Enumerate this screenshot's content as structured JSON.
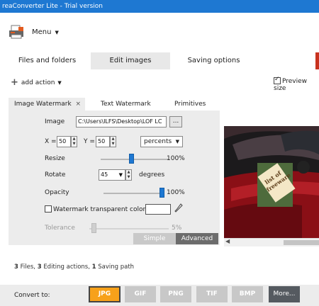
{
  "window": {
    "title": "reaConverter Lite - Trial version"
  },
  "menu": {
    "label": "Menu"
  },
  "tabs": [
    {
      "label": "Files and folders",
      "active": false
    },
    {
      "label": "Edit images",
      "active": true
    },
    {
      "label": "Saving options",
      "active": false
    }
  ],
  "toolbar": {
    "add_action": "add action",
    "preview_size": "Preview size",
    "preview_checked": true
  },
  "subtabs": [
    {
      "label": "Image Watermark",
      "active": true,
      "close": "×"
    },
    {
      "label": "Text Watermark",
      "active": false
    },
    {
      "label": "Primitives",
      "active": false
    }
  ],
  "watermark": {
    "image_label": "Image",
    "image_path": "C:\\Users\\ILFS\\Desktop\\LOF LC",
    "browse": "...",
    "x_label": "X =",
    "x_value": "50",
    "y_label": "Y =",
    "y_value": "50",
    "unit": "percents",
    "resize_label": "Resize",
    "resize_value": "100%",
    "resize_level": 0.45,
    "rotate_label": "Rotate",
    "rotate_value": "45",
    "rotate_unit": "degrees",
    "opacity_label": "Opacity",
    "opacity_value": "100%",
    "opacity_level": 1.0,
    "transparent_label": "Watermark transparent color",
    "tolerance_label": "Tolerance",
    "tolerance_value": "5%",
    "tolerance_level": 0.05,
    "mode_simple": "Simple",
    "mode_advanced": "Advanced"
  },
  "preview_watermark_text": [
    "list of",
    "freeware"
  ],
  "summary": {
    "files_count": "3",
    "files_text": "Files,",
    "actions_count": "3",
    "actions_text": "Editing actions,",
    "paths_count": "1",
    "paths_text": "Saving path"
  },
  "convert": {
    "label": "Convert to:",
    "formats": [
      "JPG",
      "GIF",
      "PNG",
      "TIF",
      "BMP"
    ],
    "selected": "JPG",
    "more": "More..."
  },
  "colors": {
    "accent": "#1e78d2",
    "selected_format": "#f7a11a",
    "more_button": "#555a60",
    "tab_highlight": "#c8321e"
  }
}
